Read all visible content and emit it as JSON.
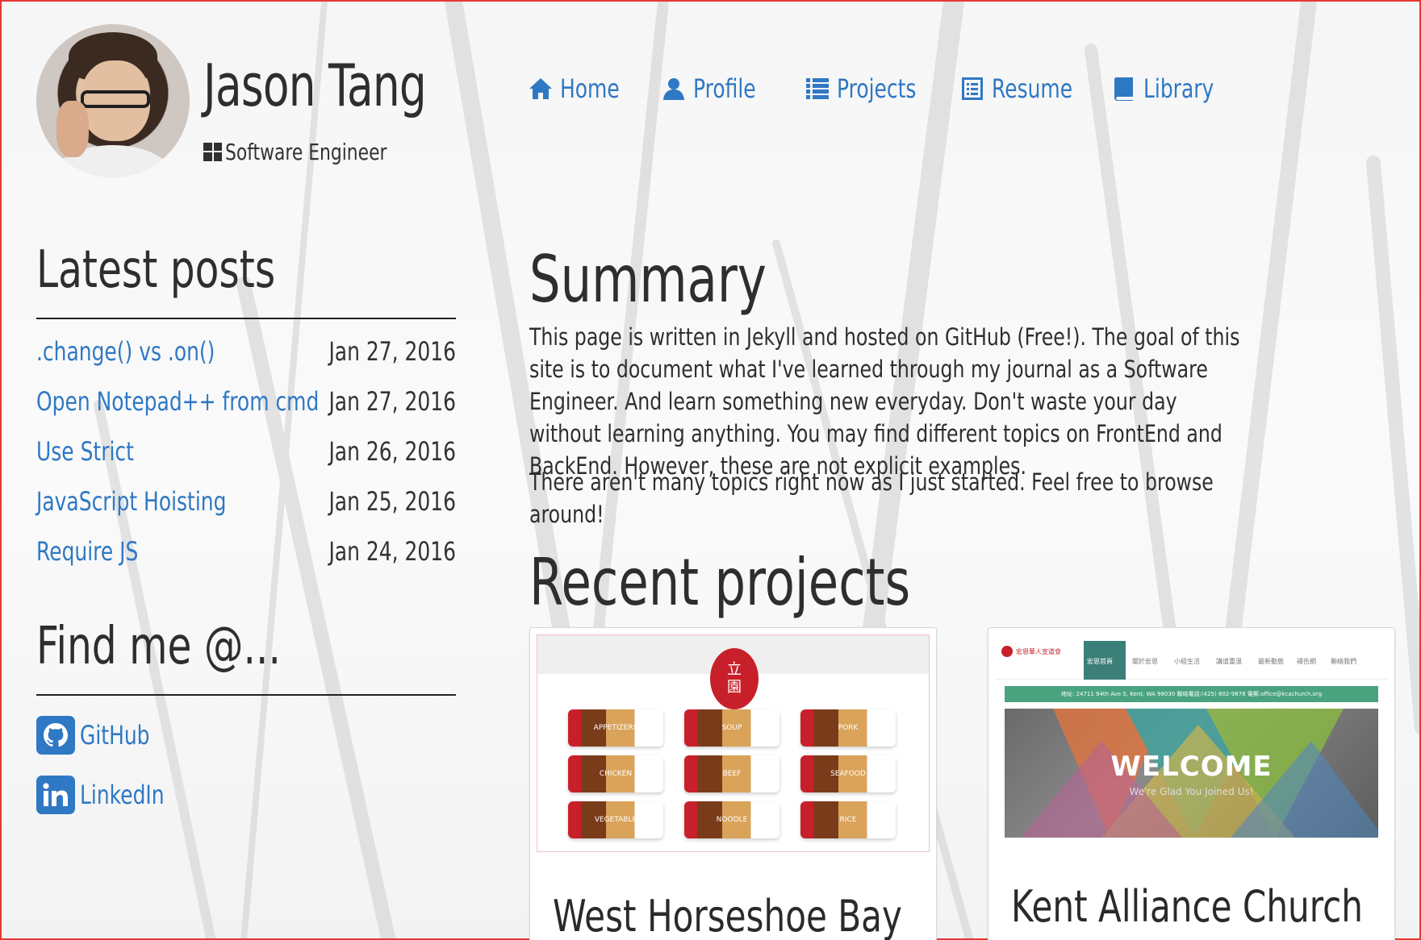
{
  "header": {
    "name": "Jason Tang",
    "role": "Software Engineer"
  },
  "nav": [
    {
      "label": "Home",
      "icon": "home-icon"
    },
    {
      "label": "Profile",
      "icon": "user-icon"
    },
    {
      "label": "Projects",
      "icon": "list-icon"
    },
    {
      "label": "Resume",
      "icon": "document-icon"
    },
    {
      "label": "Library",
      "icon": "book-icon"
    }
  ],
  "sidebar": {
    "latest_title": "Latest posts",
    "posts": [
      {
        "title": ".change() vs .on()",
        "date": "Jan 27, 2016"
      },
      {
        "title": "Open Notepad++ from cmd",
        "date": "Jan 27, 2016"
      },
      {
        "title": "Use Strict",
        "date": "Jan 26, 2016"
      },
      {
        "title": "JavaScript Hoisting",
        "date": "Jan 25, 2016"
      },
      {
        "title": "Require JS",
        "date": "Jan 24, 2016"
      }
    ],
    "find_title": "Find me @...",
    "social": [
      {
        "label": "GitHub",
        "icon": "github-icon"
      },
      {
        "label": "LinkedIn",
        "icon": "linkedin-icon"
      }
    ]
  },
  "main": {
    "summary_title": "Summary",
    "summary_p1": "This page is written in Jekyll and hosted on GitHub (Free!). The goal of this site is to document what I've learned through my journal as a Software Engineer. And learn something new everyday. Don't waste your day without learning anything. You may find different topics on FrontEnd and BackEnd. However, these are not explicit examples.",
    "summary_p2": "There aren't many topics right now as I just started. Feel free to browse around!",
    "projects_title": "Recent projects",
    "projects": [
      {
        "title": "West Horseshoe Bay",
        "thumb_badge_top": "立",
        "thumb_badge_bottom": "園",
        "thumb_items": [
          "APPETIZERS",
          "SOUP",
          "PORK",
          "CHICKEN",
          "BEEF",
          "SEAFOOD",
          "VEGETABLE",
          "NOODLE",
          "RICE"
        ]
      },
      {
        "title": "Kent Alliance Church",
        "thumb_brand": "宏恩華人宣道會",
        "thumb_nav": [
          "宏恩首頁",
          "關於宏恩",
          "小組生活",
          "講道重溫",
          "最新動態",
          "禱告網",
          "聯絡我們"
        ],
        "thumb_address": "地址: 24711 94th Ave S, Kent, WA 98030 聯絡電話:(425) 802-9878 電郵:office@kcachurch.org",
        "thumb_hero_title": "WELCOME",
        "thumb_hero_sub": "We're Glad You Joined Us!"
      }
    ]
  },
  "colors": {
    "link": "#2f78c4",
    "text": "#2e2e2e",
    "frame": "#e53935"
  }
}
